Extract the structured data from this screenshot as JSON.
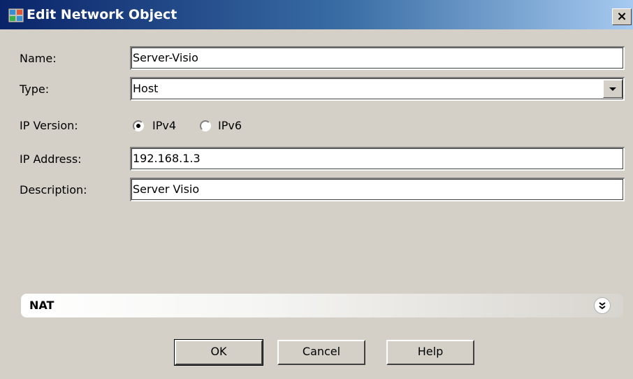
{
  "window": {
    "title": "Edit Network Object",
    "close_label": "×"
  },
  "form": {
    "name_label": "Name:",
    "name_value": "Server-Visio",
    "type_label": "Type:",
    "type_value": "Host",
    "ip_version_label": "IP Version:",
    "ipv4_label": "IPv4",
    "ipv6_label": "IPv6",
    "ip_version_selected": "IPv4",
    "ip_address_label": "IP Address:",
    "ip_address_value": "192.168.1.3",
    "description_label": "Description:",
    "description_value": "Server Visio"
  },
  "nat": {
    "label": "NAT",
    "expand_glyph": "»"
  },
  "buttons": {
    "ok_label": "OK",
    "cancel_label": "Cancel",
    "help_label": "Help"
  },
  "icons": {
    "title_icon": "network-object-icon",
    "close": "close-icon",
    "expand": "expand-chevron-icon",
    "dropdown": "chevron-down-icon"
  },
  "colors": {
    "titlebar_start": "#0a246a",
    "titlebar_end": "#a6caf0",
    "dialog_bg": "#d4d0c8"
  }
}
